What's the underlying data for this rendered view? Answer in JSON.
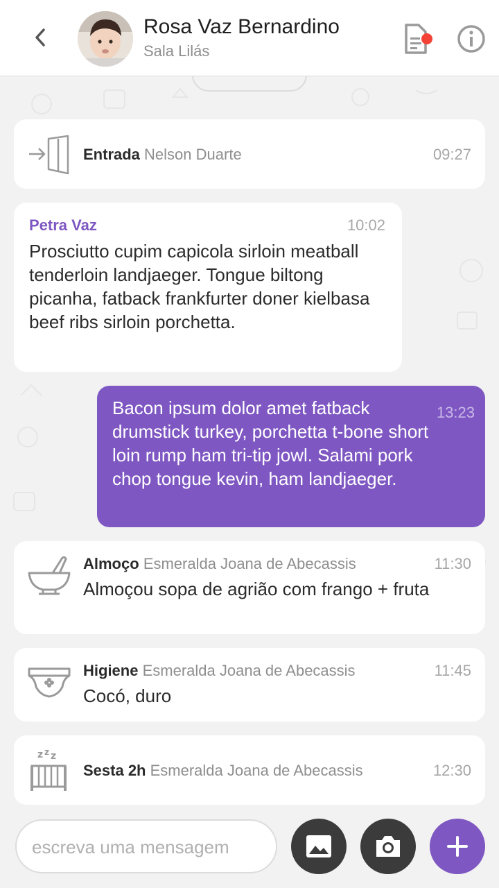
{
  "header": {
    "name": "Rosa Vaz Bernardino",
    "room": "Sala Lilás"
  },
  "events": {
    "entrada": {
      "kind": "Entrada",
      "who": "Nelson Duarte",
      "time": "09:27"
    },
    "almoco": {
      "kind": "Almoço",
      "who": "Esmeralda Joana de Abecassis",
      "time": "11:30",
      "text": "Almoçou sopa de agrião com frango + fruta"
    },
    "higiene": {
      "kind": "Higiene",
      "who": "Esmeralda Joana de Abecassis",
      "time": "11:45",
      "text": "Cocó, duro"
    },
    "sesta": {
      "kind": "Sesta 2h",
      "who": "Esmeralda Joana de Abecassis",
      "time": "12:30"
    }
  },
  "messages": {
    "incoming": {
      "sender": "Petra Vaz",
      "time": "10:02",
      "text": "Prosciutto cupim capicola sirloin meatball tenderloin landjaeger. Tongue biltong picanha, fatback frankfurter doner kielbasa beef ribs sirloin porchetta."
    },
    "outgoing": {
      "time": "13:23",
      "text": "Bacon ipsum dolor amet fatback drumstick turkey, porchetta t-bone short loin rump ham tri-tip jowl. Salami pork chop tongue kevin, ham landjaeger."
    }
  },
  "composer": {
    "placeholder": "escreva uma mensagem"
  },
  "colors": {
    "accent": "#7e57c2",
    "notification_dot": "#f44336"
  }
}
